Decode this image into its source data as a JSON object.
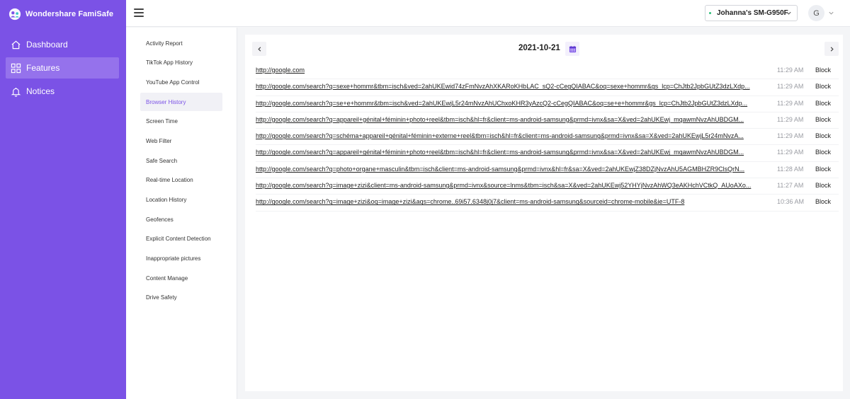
{
  "app": {
    "brand_name": "Wondershare FamiSafe"
  },
  "sidebar": {
    "items": [
      {
        "label": "Dashboard",
        "icon": "home-icon"
      },
      {
        "label": "Features",
        "icon": "grid-icon"
      },
      {
        "label": "Notices",
        "icon": "bell-icon"
      }
    ],
    "active_index": 1,
    "background": "#7b52e6",
    "active_background": "#9572ec"
  },
  "topbar": {
    "device_name": "Johanna's SM-G950F",
    "avatar_initial": "G"
  },
  "submenu": {
    "items": [
      "Activity Report",
      "TikTok App History",
      "YouTube App Control",
      "Browser History",
      "Screen Time",
      "Web Filter",
      "Safe Search",
      "Real-time Location",
      "Location History",
      "Geofences",
      "Explicit Content Detection",
      "Inappropriate pictures",
      "Content Manage",
      "Drive Safety"
    ],
    "active_index": 3
  },
  "history": {
    "date": "2021-10-21",
    "block_label": "Block",
    "rows": [
      {
        "url": "http://google.com",
        "time": "11:29 AM"
      },
      {
        "url": "http://google.com/search?q=sexe+hommr&tbm=isch&ved=2ahUKEwid74zFmNvzAhXKARoKHbLAC_sQ2-cCegQIABAC&oq=sexe+hommr&gs_lcp=ChJtb2JpbGUtZ3dzLXdp...",
        "time": "11:29 AM"
      },
      {
        "url": "http://google.com/search?q=se+e+hommr&tbm=isch&ved=2ahUKEwjL5r24mNvzAhUChxoKHR3yAzcQ2-cCegQIABAC&oq=se+e+hommr&gs_lcp=ChJtb2JpbGUtZ3dzLXdp...",
        "time": "11:29 AM"
      },
      {
        "url": "http://google.com/search?q=appareil+génital+féminin+photo+reel&tbm=isch&hl=fr&client=ms-android-samsung&prmd=ivnx&sa=X&ved=2ahUKEwj_mqawmNvzAhUBDGM...",
        "time": "11:29 AM"
      },
      {
        "url": "http://google.com/search?q=schéma+appareil+génital+féminin+externe+reel&tbm=isch&hl=fr&client=ms-android-samsung&prmd=ivnx&sa=X&ved=2ahUKEwjL5r24mNvzA...",
        "time": "11:29 AM"
      },
      {
        "url": "http://google.com/search?q=appareil+génital+féminin+photo+reel&tbm=isch&hl=fr&client=ms-android-samsung&prmd=ivnx&sa=X&ved=2ahUKEwj_mqawmNvzAhUBDGM...",
        "time": "11:29 AM"
      },
      {
        "url": "http://google.com/search?q=photo+organe+masculin&tbm=isch&client=ms-android-samsung&prmd=ivnx&hl=fr&sa=X&ved=2ahUKEwjZ38DZjNvzAhU5AGMBHZR9ClsQrN...",
        "time": "11:28 AM"
      },
      {
        "url": "http://google.com/search?q=image+zizi&client=ms-android-samsung&prmd=ivnx&source=lnms&tbm=isch&sa=X&ved=2ahUKEwj52YHYjNvzAhWQ3eAKHchVCtkQ_AUoAXo...",
        "time": "11:27 AM"
      },
      {
        "url": "http://google.com/search?q=image+zizi&oq=image+zizi&aqs=chrome..69i57.6348j0j7&client=ms-android-samsung&sourceid=chrome-mobile&ie=UTF-8",
        "time": "10:36 AM"
      }
    ]
  }
}
